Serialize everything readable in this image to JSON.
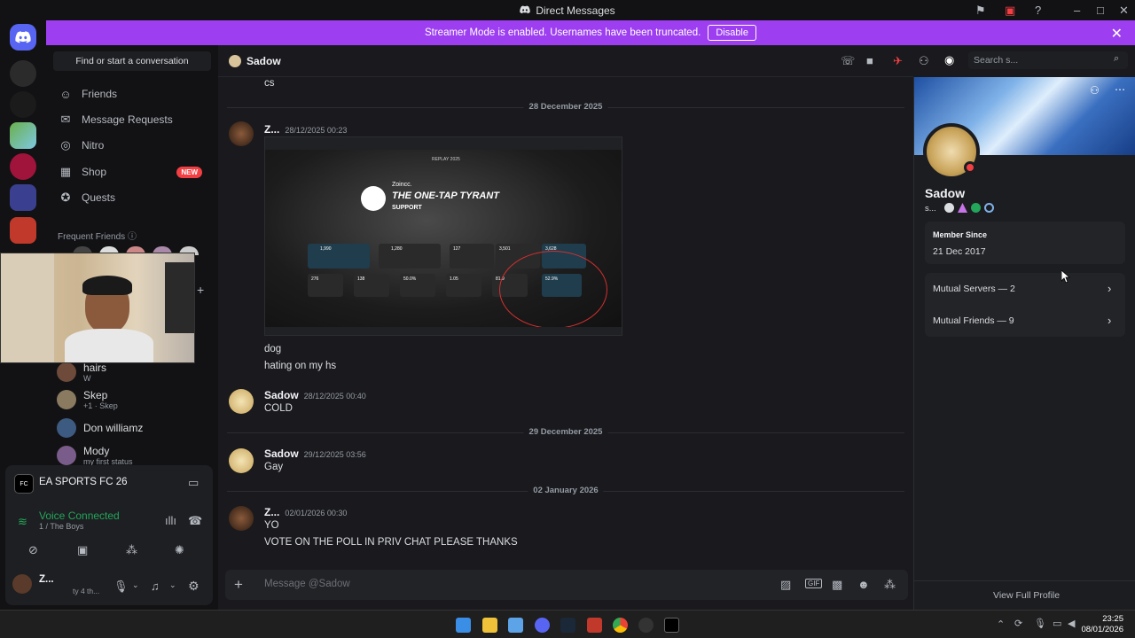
{
  "window": {
    "title": "Direct Messages"
  },
  "banner": {
    "text": "Streamer Mode is enabled. Usernames have been truncated.",
    "button": "Disable"
  },
  "sidebar": {
    "find_placeholder": "Find or start a conversation",
    "nav": [
      {
        "label": "Friends",
        "icon": "friends-icon"
      },
      {
        "label": "Message Requests",
        "icon": "mail-icon"
      },
      {
        "label": "Nitro",
        "icon": "nitro-icon"
      },
      {
        "label": "Shop",
        "icon": "shop-icon",
        "badge": "NEW"
      },
      {
        "label": "Quests",
        "icon": "quests-icon"
      }
    ],
    "frequent_title": "Frequent Friends",
    "dms": [
      {
        "name": "hairs",
        "sub": "W"
      },
      {
        "name": "Skep",
        "sub": "+1 · Skep"
      },
      {
        "name": "Don williamz",
        "sub": ""
      },
      {
        "name": "Mody",
        "sub": "my first status"
      }
    ]
  },
  "userpanel": {
    "activity": "EA SPORTS FC 26",
    "voice_status": "Voice Connected",
    "voice_channel": "1 / The Boys",
    "user_name": "Z...",
    "user_status": "ty 4 th..."
  },
  "chat": {
    "channel": "Sadow",
    "search_placeholder": "Search s...",
    "composer_placeholder": "Message @Sadow",
    "top_text": "cs",
    "dividers": [
      "28 December 2025",
      "29 December 2025",
      "02 January 2026"
    ],
    "messages": [
      {
        "author": "Z...",
        "time": "28/12/2025 00:23",
        "lines": [
          "dog",
          "hating on my hs"
        ]
      },
      {
        "author": "Sadow",
        "time": "28/12/2025 00:40",
        "lines": [
          "COLD"
        ]
      },
      {
        "author": "Sadow",
        "time": "29/12/2025 03:56",
        "lines": [
          "Gay"
        ]
      },
      {
        "author": "Z...",
        "time": "02/01/2026 00:30",
        "lines": [
          "YO",
          "VOTE ON THE POLL IN PRIV CHAT PLEASE THANKS"
        ]
      }
    ],
    "image": {
      "header": "REPLAY 2025",
      "user": "Zoincc.",
      "title": "THE ONE-TAP TYRANT",
      "subtitle": "SUPPORT",
      "stats": [
        "1,990",
        "1,280",
        "127",
        "3,501",
        "3,628",
        "276",
        "138",
        "50.0%",
        "1.05",
        "81.9",
        "52.9%"
      ]
    }
  },
  "profile": {
    "name": "Sadow",
    "tag": "s...",
    "member_since_label": "Member Since",
    "member_since": "21 Dec 2017",
    "mutual_servers": "Mutual Servers — 2",
    "mutual_friends": "Mutual Friends — 9",
    "view_full": "View Full Profile"
  },
  "taskbar": {
    "time": "23:25",
    "date": "08/01/2026"
  },
  "colors": {
    "accent": "#9d3ff0",
    "voice_green": "#23a55a",
    "new_badge": "#f23f43"
  }
}
